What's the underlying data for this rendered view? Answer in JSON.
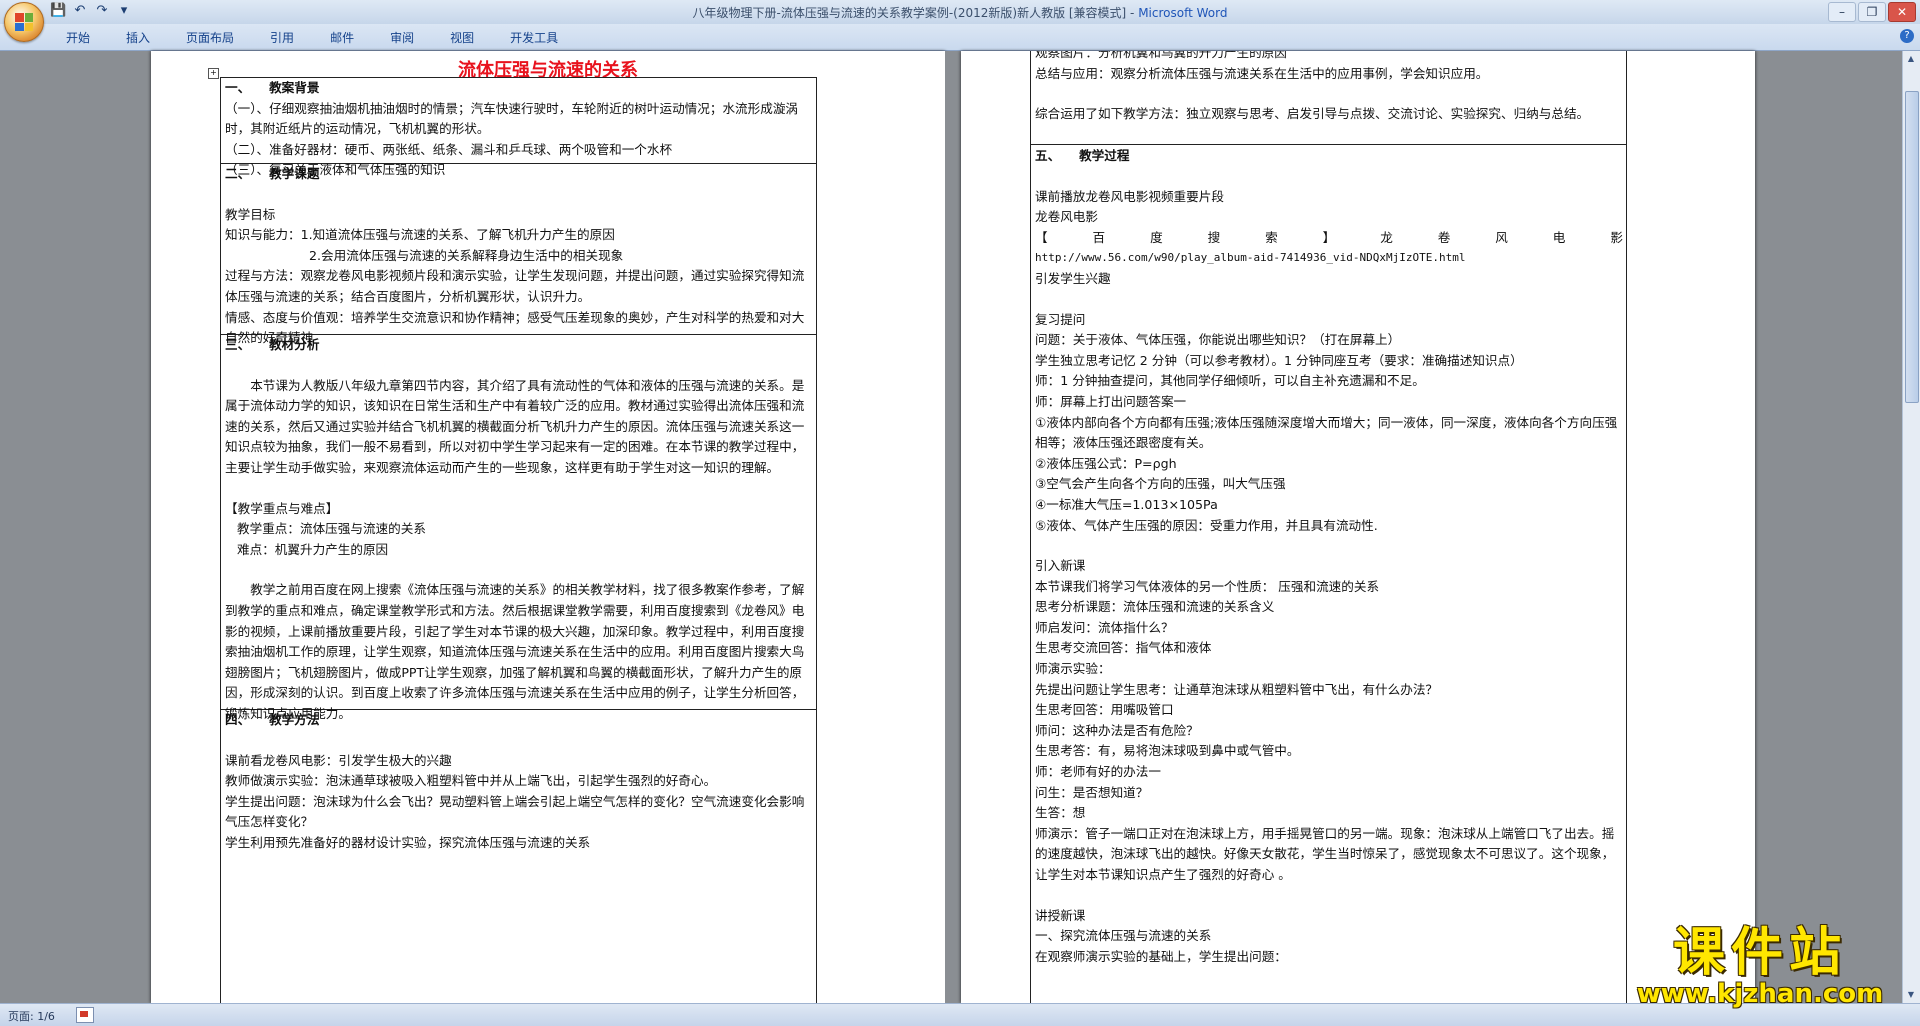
{
  "window": {
    "title_doc": "八年级物理下册-流体压强与流速的关系教学案例-(2012新版)新人教版 [兼容模式] - ",
    "title_app": "Microsoft Word"
  },
  "ribbon": {
    "tabs": [
      "开始",
      "插入",
      "页面布局",
      "引用",
      "邮件",
      "审阅",
      "视图",
      "开发工具"
    ]
  },
  "status": {
    "page": "页面: 1/6"
  },
  "watermark": {
    "line1": "课件站",
    "line2": "www.kjzhan.com"
  },
  "page1": {
    "title": "流体压强与流速的关系",
    "s1": {
      "heading": "一、　　教案背景",
      "items": [
        "（一）、仔细观察抽油烟机抽油烟时的情景；汽车快速行驶时，车轮附近的树叶运动情况；水流形成漩涡时，其附近纸片的运动情况，飞机机翼的形状。",
        "（二）、准备好器材：硬币、两张纸、纸条、漏斗和乒乓球、两个吸管和一个水杯",
        "（三）、复习关于液体和气体压强的知识"
      ]
    },
    "s2": {
      "heading": "二、　　教学课题",
      "goal_title": "教学目标",
      "k1": "知识与能力：1.知道流体压强与流速的关系、了解飞机升力产生的原因",
      "k2": "2.会用流体压强与流速的关系解释身边生活中的相关现象",
      "p": "过程与方法：观察龙卷风电影视频片段和演示实验，让学生发现问题，并提出问题，通过实验探究得知流体压强与流速的关系；结合百度图片，分析机翼形状，认识升力。",
      "e": "情感、态度与价值观：培养学生交流意识和协作精神；感受气压差现象的奥妙，产生对科学的热爱和对大自然的好奇精神"
    },
    "s3": {
      "heading": "三、　　教材分析",
      "para1": "本节课为人教版八年级九章第四节内容，其介绍了具有流动性的气体和液体的压强与流速的关系。是属于流体动力学的知识，该知识在日常生活和生产中有着较广泛的应用。教材通过实验得出流体压强和流速的关系，然后又通过实验并结合飞机机翼的横截面分析飞机升力产生的原因。流体压强与流速关系这一知识点较为抽象，我们一般不易看到，所以对初中学生学习起来有一定的困难。在本节课的教学过程中，主要让学生动手做实验，来观察流体运动而产生的一些现象，这样更有助于学生对这一知识的理解。",
      "key_title": "【教学重点与难点】",
      "key1": "教学重点：流体压强与流速的关系",
      "key2": "难点：机翼升力产生的原因",
      "para2": "教学之前用百度在网上搜索《流体压强与流速的关系》的相关教学材料，找了很多教案作参考，了解到教学的重点和难点，确定课堂教学形式和方法。然后根据课堂教学需要，利用百度搜索到《龙卷风》电影的视频，上课前播放重要片段，引起了学生对本节课的极大兴趣，加深印象。教学过程中，利用百度搜索抽油烟机工作的原理，让学生观察，知道流体压强与流速关系在生活中的应用。利用百度图片搜索大鸟翅膀图片；飞机翅膀图片，做成PPT让学生观察，加强了解机翼和鸟翼的横截面形状，了解升力产生的原因，形成深刻的认识。到百度上收索了许多流体压强与流速关系在生活中应用的例子，让学生分析回答，锻炼知识点应用能力。"
    },
    "s4": {
      "heading": "四、　　教学方法",
      "l1": "课前看龙卷风电影：引发学生极大的兴趣",
      "l2": "教师做演示实验：泡沫通草球被吸入粗塑料管中并从上端飞出，引起学生强烈的好奇心。",
      "l3": "学生提出问题：泡沫球为什么会飞出？晃动塑料管上端会引起上端空气怎样的变化？空气流速变化会影响气压怎样变化？",
      "l4": "学生利用预先准备好的器材设计实验，探究流体压强与流速的关系"
    }
  },
  "page2": {
    "top": {
      "l1": "观察图片：分析机翼和鸟翼的升力产生的原因",
      "l2": "总结与应用：观察分析流体压强与流速关系在生活中的应用事例，学会知识应用。",
      "l3": "综合运用了如下教学方法：独立观察与思考、启发引导与点拨、交流讨论、实验探究、归纳与总结。"
    },
    "s5": {
      "heading": "五、　　教学过程",
      "a1": "课前播放龙卷风电影视频重要片段",
      "a2": "龙卷风电影",
      "link_words": [
        "【",
        "百",
        "度",
        "搜",
        "索",
        "】",
        "龙",
        "卷",
        "风",
        "电",
        "影"
      ],
      "url": "http://www.56.com/w90/play_album-aid-7414936_vid-NDQxMjIzOTE.html",
      "a3": "引发学生兴趣",
      "b0": "复习提问",
      "b1": "问题：关于液体、气体压强，你能说出哪些知识？（打在屏幕上）",
      "b2": "学生独立思考记忆 2 分钟（可以参考教材）。1 分钟同座互考（要求：准确描述知识点）",
      "b3": "师：1 分钟抽查提问，其他同学仔细倾听，可以自主补充遗漏和不足。",
      "b4": "师：屏幕上打出问题答案一",
      "b5": "①液体内部向各个方向都有压强;液体压强随深度增大而增大；同一液体，同一深度，液体向各个方向压强相等；液体压强还跟密度有关。",
      "b6": "②液体压强公式：P=ρgh",
      "b7": "③空气会产生向各个方向的压强，叫大气压强",
      "b8": "④一标准大气压=1.013×105Pa",
      "b9": "⑤液体、气体产生压强的原因：受重力作用，并且具有流动性.",
      "c0": "引入新课",
      "c1": "本节课我们将学习气体液体的另一个性质： 压强和流速的关系",
      "c2": "思考分析课题：流体压强和流速的关系含义",
      "c3": "师启发问：流体指什么？",
      "c4": "生思考交流回答：指气体和液体",
      "c5": "师演示实验：",
      "c6": "先提出问题让学生思考：让通草泡沫球从粗塑料管中飞出，有什么办法？",
      "c7": "生思考回答：用嘴吸管口",
      "c8": "师问：这种办法是否有危险？",
      "c9": "生思考答：有，易将泡沫球吸到鼻中或气管中。",
      "c10": "师：老师有好的办法一",
      "c11": "问生：是否想知道？",
      "c12": "生答：想",
      "c13": "师演示：管子一端口正对在泡沫球上方，用手摇晃管口的另一端。现象：泡沫球从上端管口飞了出去。摇的速度越快，泡沫球飞出的越快。好像天女散花，学生当时惊呆了，感觉现象太不可思议了。这个现象，让学生对本节课知识点产生了强烈的好奇心 。",
      "d0": "讲授新课",
      "d1": "一、探究流体压强与流速的关系",
      "d2": "在观察师演示实验的基础上，学生提出问题："
    }
  }
}
